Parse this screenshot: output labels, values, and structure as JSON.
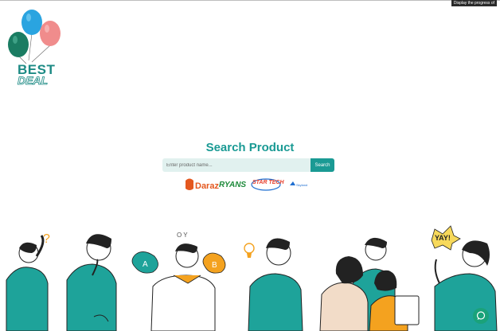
{
  "tooltip": {
    "text": "Display the progress of"
  },
  "logo": {
    "line1": "BEST",
    "line2": "DEAL"
  },
  "search": {
    "title": "Search Product",
    "placeholder": "Enter product name...",
    "button_label": "Search"
  },
  "brands": [
    {
      "name": "Daraz",
      "color": "#e4581f"
    },
    {
      "name": "RYANS",
      "color": "#1d8a3a"
    },
    {
      "name": "STAR TECH",
      "color": "#e8402d"
    },
    {
      "name": "Skyland",
      "color": "#1f6fd1"
    }
  ],
  "illustration": {
    "speech_text": "YAY!",
    "bubble_a": "A",
    "bubble_b": "B",
    "thought_text": "O Y"
  },
  "colors": {
    "accent": "#1a9a94",
    "input_bg": "#e1f1ef",
    "shirt_teal": "#1ea39a",
    "bubble_orange": "#f4a21f",
    "chat_green": "#1aa27a"
  },
  "icons": {
    "chat": "chat-bubble-icon"
  }
}
